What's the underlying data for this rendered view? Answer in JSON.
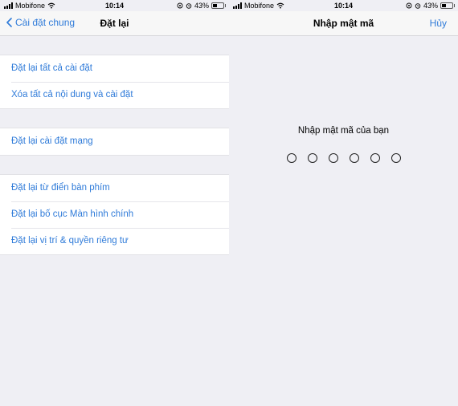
{
  "left": {
    "status": {
      "carrier": "Mobifone",
      "time": "10:14",
      "battery": "43%",
      "battery_level": 0.43
    },
    "nav": {
      "back_label": "Cài đặt chung",
      "title": "Đặt lại"
    },
    "groups": [
      [
        "Đặt lại tất cả cài đặt",
        "Xóa tất cả nội dung và cài đặt"
      ],
      [
        "Đặt lại cài đặt mạng"
      ],
      [
        "Đặt lại từ điển bàn phím",
        "Đặt lại bố cục Màn hình chính",
        "Đặt lại vị trí & quyền riêng tư"
      ]
    ]
  },
  "right": {
    "status": {
      "carrier": "Mobifone",
      "time": "10:14",
      "battery": "43%",
      "battery_level": 0.43
    },
    "nav": {
      "title": "Nhập mật mã",
      "cancel_label": "Hủy"
    },
    "prompt": "Nhập mật mã của bạn",
    "passcode_length": 6
  }
}
